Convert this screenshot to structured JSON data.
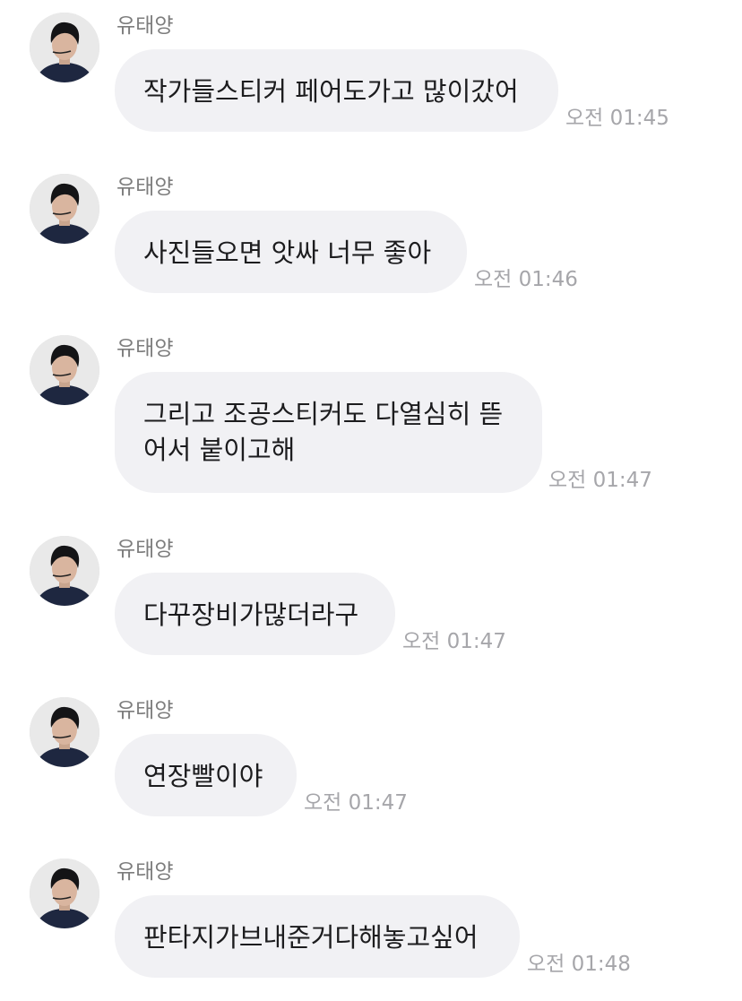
{
  "messages": [
    {
      "sender": "유태양",
      "text": "작가들스티커 페어도가고 많이갔어",
      "time": "오전 01:45"
    },
    {
      "sender": "유태양",
      "text": "사진들오면 앗싸 너무 좋아",
      "time": "오전 01:46"
    },
    {
      "sender": "유태양",
      "text": "그리고 조공스티커도 다열심히 뜯\n어서 붙이고해",
      "time": "오전 01:47"
    },
    {
      "sender": "유태양",
      "text": "다꾸장비가많더라구",
      "time": "오전 01:47"
    },
    {
      "sender": "유태양",
      "text": "연장빨이야",
      "time": "오전 01:47"
    },
    {
      "sender": "유태양",
      "text": "판타지가브내준거다해놓고싶어",
      "time": "오전 01:48"
    }
  ]
}
